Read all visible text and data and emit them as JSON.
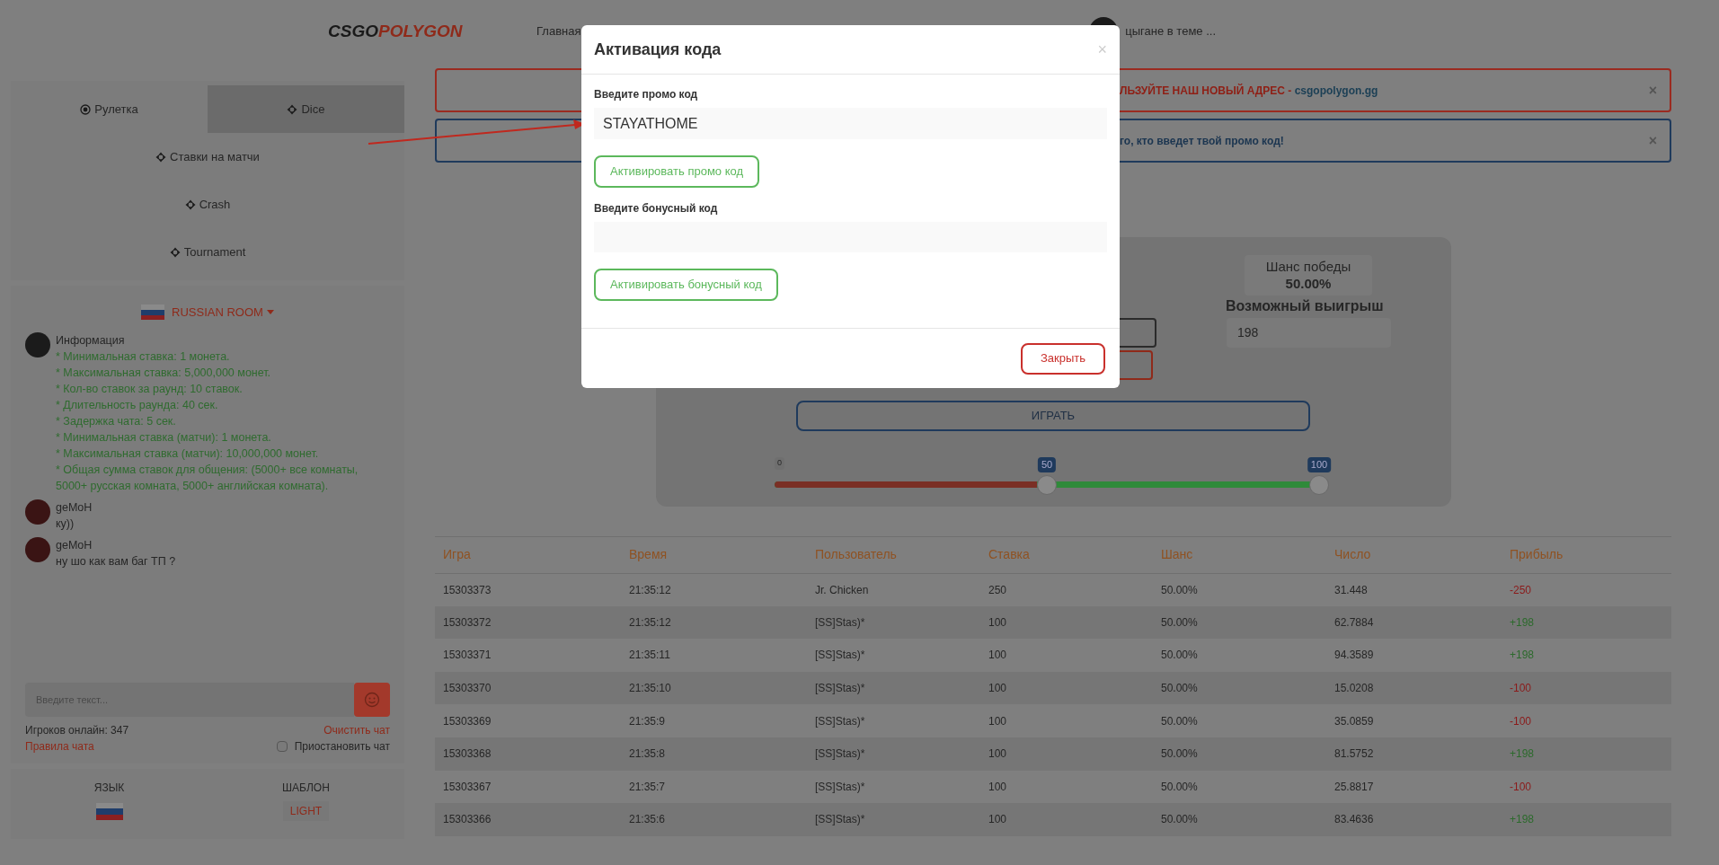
{
  "header": {
    "logo": [
      "CSGO",
      "POLYGON"
    ],
    "nav": [
      "Главная"
    ],
    "user": "цыгане в теме ..."
  },
  "game_menu": [
    {
      "label": "Рулетка",
      "selected": false
    },
    {
      "label": "Dice",
      "selected": true
    },
    {
      "label": "Ставки на матчи",
      "selected": false
    },
    {
      "label": "Crash",
      "selected": false
    },
    {
      "label": "Tournament",
      "selected": false
    }
  ],
  "chat": {
    "room": "RUSSIAN ROOM",
    "messages": [
      {
        "kind": "info",
        "author": "Информация",
        "lines": [
          "* Минимальная ставка: 1 монета.",
          "* Максимальная ставка: 5,000,000 монет.",
          "* Кол-во ставок за раунд: 10 ставок.",
          "* Длительность раунда: 40 сек.",
          "* Задержка чата: 5 сек.",
          "* Минимальная ставка (матчи): 1 монета.",
          "* Максимальная ставка (матчи): 10,000,000 монет.",
          "* Общая сумма ставок для общения: (5000+ все комнаты, 5000+ русская комната, 5000+ английская комната)."
        ]
      },
      {
        "kind": "user",
        "author": "geMoH",
        "lines": [
          "ку))"
        ]
      },
      {
        "kind": "user",
        "author": "geMoH",
        "lines": [
          "ну шо как вам баг ТП ?"
        ]
      }
    ],
    "placeholder": "Введите текст...",
    "online": "Игроков онлайн: 347",
    "clear": "Очистить чат",
    "rules": "Правила чата",
    "pause": {
      "label": "Приостановить чат",
      "checked": false
    }
  },
  "settings": {
    "language_label": "ЯЗЫК",
    "template_label": "ШАБЛОН",
    "template": "LIGHT"
  },
  "alerts": [
    {
      "kind": "danger",
      "text": "ЛЬЗУЙТЕ НАШ НОВЫЙ АДРЕС - ",
      "link": "csgopolygon.gg",
      "close": "×"
    },
    {
      "kind": "info",
      "text": "го, кто введет твой промо код!",
      "close": "×"
    }
  ],
  "dice": {
    "chance_label": "Шанс победы",
    "chance": "50.00%",
    "payout_label": "Возможный выигрыш",
    "payout": "198",
    "play": "ИГРАТЬ",
    "slider": {
      "min": "0",
      "value": "50",
      "max": "100",
      "level": 0.5
    }
  },
  "table": {
    "columns": [
      "Игра",
      "Время",
      "Пользователь",
      "Ставка",
      "Шанс",
      "Число",
      "Прибыль"
    ],
    "rows": [
      {
        "kind": "loss",
        "cells": [
          "15303373",
          "21:35:12",
          "Jr. Chicken",
          "250",
          "50.00%",
          "31.448",
          "-250"
        ]
      },
      {
        "kind": "win",
        "cells": [
          "15303372",
          "21:35:12",
          "[SS]Stas)*",
          "100",
          "50.00%",
          "62.7884",
          "+198"
        ]
      },
      {
        "kind": "win",
        "cells": [
          "15303371",
          "21:35:11",
          "[SS]Stas)*",
          "100",
          "50.00%",
          "94.3589",
          "+198"
        ]
      },
      {
        "kind": "loss",
        "cells": [
          "15303370",
          "21:35:10",
          "[SS]Stas)*",
          "100",
          "50.00%",
          "15.0208",
          "-100"
        ]
      },
      {
        "kind": "loss",
        "cells": [
          "15303369",
          "21:35:9",
          "[SS]Stas)*",
          "100",
          "50.00%",
          "35.0859",
          "-100"
        ]
      },
      {
        "kind": "win",
        "cells": [
          "15303368",
          "21:35:8",
          "[SS]Stas)*",
          "100",
          "50.00%",
          "81.5752",
          "+198"
        ]
      },
      {
        "kind": "loss",
        "cells": [
          "15303367",
          "21:35:7",
          "[SS]Stas)*",
          "100",
          "50.00%",
          "25.8817",
          "-100"
        ]
      },
      {
        "kind": "win",
        "cells": [
          "15303366",
          "21:35:6",
          "[SS]Stas)*",
          "100",
          "50.00%",
          "83.4636",
          "+198"
        ]
      }
    ]
  },
  "modal": {
    "title": "Активация кода",
    "close": "×",
    "promo_label": "Введите промо код",
    "promo_value": "STAYATHOME",
    "promo_button": "Активировать промо код",
    "bonus_label": "Введите бонусный код",
    "bonus_button": "Активировать бонусный код",
    "footer_button": "Закрыть"
  }
}
